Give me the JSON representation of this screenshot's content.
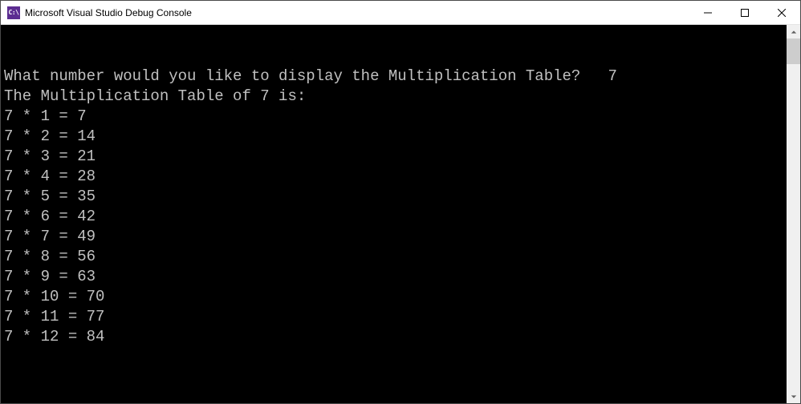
{
  "window": {
    "app_icon_text": "C:\\",
    "title": "Microsoft Visual Studio Debug Console"
  },
  "console": {
    "prompt": "What number would you like to display the Multiplication Table?   7",
    "header": "The Multiplication Table of 7 is:",
    "rows": [
      "7 * 1 = 7",
      "7 * 2 = 14",
      "7 * 3 = 21",
      "7 * 4 = 28",
      "7 * 5 = 35",
      "7 * 6 = 42",
      "7 * 7 = 49",
      "7 * 8 = 56",
      "7 * 9 = 63",
      "7 * 10 = 70",
      "7 * 11 = 77",
      "7 * 12 = 84"
    ]
  }
}
